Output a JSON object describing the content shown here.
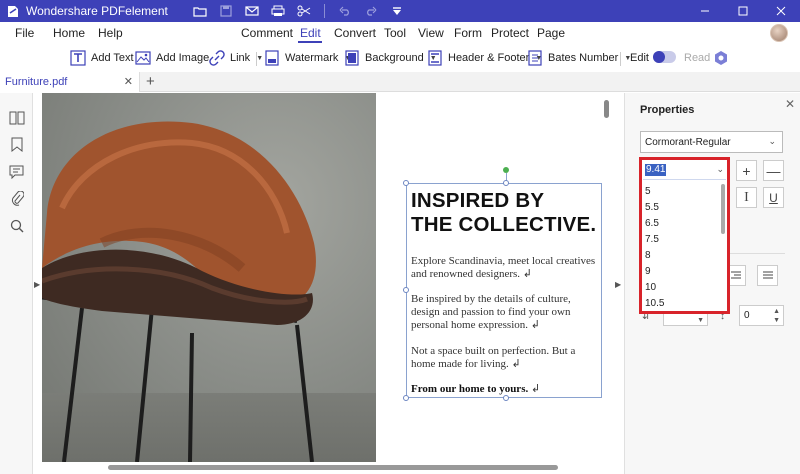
{
  "app": {
    "title": "Wondershare PDFelement"
  },
  "quick_access": [
    "folder-icon",
    "save-icon",
    "mail-icon",
    "print-icon",
    "scissors-icon",
    "undo-icon",
    "redo-icon",
    "dropdown-icon"
  ],
  "window_controls": [
    "minimize",
    "maximize",
    "close"
  ],
  "menu": {
    "file": "File",
    "home": "Home",
    "help": "Help",
    "comment": "Comment",
    "edit": "Edit",
    "convert": "Convert",
    "tool": "Tool",
    "view": "View",
    "form": "Form",
    "protect": "Protect",
    "page": "Page"
  },
  "toolbar": {
    "add_text": "Add Text",
    "add_image": "Add Image",
    "link": "Link",
    "watermark": "Watermark",
    "background": "Background",
    "header_footer": "Header & Footer",
    "bates_number": "Bates Number",
    "edit_mode": "Edit",
    "read_mode": "Read"
  },
  "tab": {
    "name": "Furniture.pdf"
  },
  "document": {
    "heading_line1": "INSPIRED BY",
    "heading_line2": "THE COLLECTIVE.",
    "p1_line1": "Explore Scandinavia, meet local creatives",
    "p1_line2": "and renowned designers. ↲",
    "p2_line1": "Be inspired by the details of culture,",
    "p2_line2": "design and passion to find your own",
    "p2_line3": "personal home expression. ↲",
    "p3_line1": "Not a space built on perfection. But a",
    "p3_line2": "home made for living. ↲",
    "p4_line1": "From our home to yours.",
    "p4_mark": " ↲"
  },
  "properties": {
    "title": "Properties",
    "font_name": "Cormorant-Regular",
    "font_size_value": "9.41",
    "font_size_options": [
      "5",
      "5.5",
      "6.5",
      "7.5",
      "8",
      "9",
      "10",
      "10.5"
    ],
    "spacing_value": "0"
  }
}
